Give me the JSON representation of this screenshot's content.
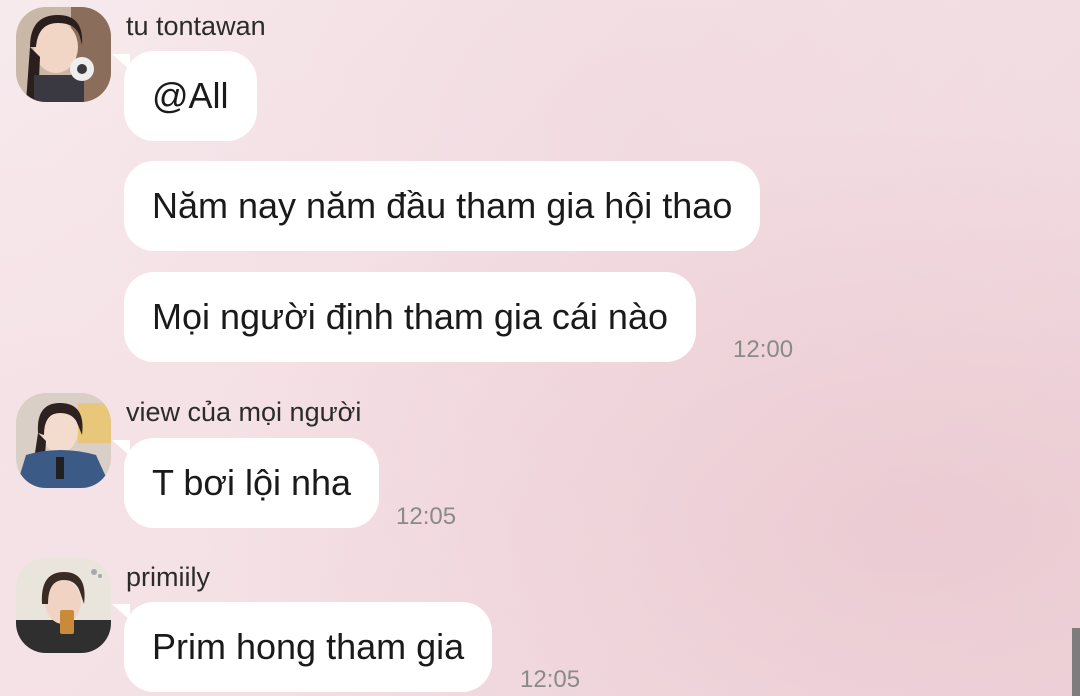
{
  "messages": [
    {
      "sender": "tu tontawan",
      "texts": [
        "@All",
        "Năm nay năm đầu tham gia hội thao",
        "Mọi người định tham gia cái nào"
      ],
      "time": "12:00"
    },
    {
      "sender": "view của mọi người",
      "texts": [
        "T bơi lội nha"
      ],
      "time": "12:05"
    },
    {
      "sender": "primiily",
      "texts": [
        "Prim hong tham gia"
      ],
      "time": "12:05"
    }
  ],
  "icons": {
    "avatar_1": "user-avatar",
    "avatar_2": "user-avatar",
    "avatar_3": "user-avatar"
  },
  "colors": {
    "bubble": "#ffffff",
    "background": "#f5e4e8",
    "timestamp": "#8a8a8a"
  }
}
